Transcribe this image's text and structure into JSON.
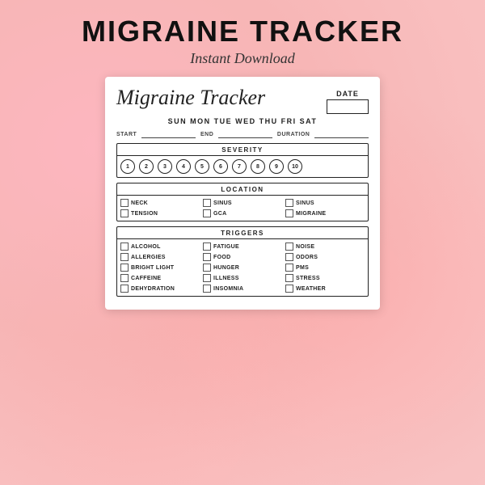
{
  "header": {
    "main_title": "MIGRAINE TRACKER",
    "subtitle": "Instant Download"
  },
  "paper": {
    "script_title": "Migraine Tracker",
    "date_label": "DATE",
    "days": "SUN MON TUE WED THU FRI SAT",
    "start_label": "START",
    "end_label": "END",
    "duration_label": "DURATION"
  },
  "severity": {
    "title": "SEVERITY",
    "numbers": [
      1,
      2,
      3,
      4,
      5,
      6,
      7,
      8,
      9,
      10
    ]
  },
  "location": {
    "title": "LOCATION",
    "items": [
      {
        "label": "NECK"
      },
      {
        "label": "SINUS"
      },
      {
        "label": "SINUS"
      },
      {
        "label": "TENSION"
      },
      {
        "label": "GCA"
      },
      {
        "label": "MIGRAINE"
      }
    ]
  },
  "triggers": {
    "title": "TRIGGERS",
    "items": [
      {
        "label": "ALCOHOL"
      },
      {
        "label": "FATIGUE"
      },
      {
        "label": "NOISE"
      },
      {
        "label": "ALLERGIES"
      },
      {
        "label": "FOOD"
      },
      {
        "label": "ODORS"
      },
      {
        "label": "BRIGHT LIGHT"
      },
      {
        "label": "HUNGER"
      },
      {
        "label": "PMS"
      },
      {
        "label": "CAFFEINE"
      },
      {
        "label": "ILLNESS"
      },
      {
        "label": "STRESS"
      },
      {
        "label": "DEHYDRATION"
      },
      {
        "label": "INSOMNIA"
      },
      {
        "label": "WEATHER"
      }
    ]
  }
}
